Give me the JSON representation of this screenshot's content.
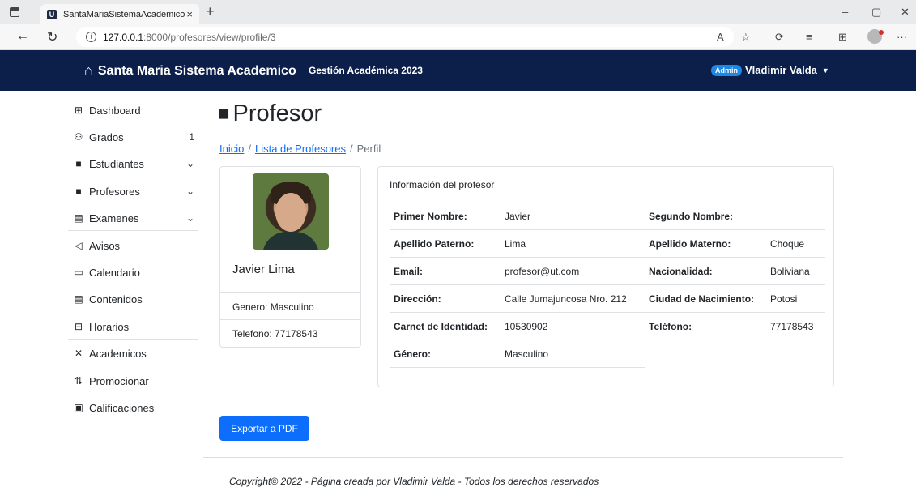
{
  "browser": {
    "tab_title": "SantaMariaSistemaAcademico",
    "tab_close": "×",
    "new_tab": "+",
    "favicon": "U",
    "url_host": "127.0.0.1",
    "url_path": ":8000/profesores/view/profile/3",
    "window_min": "–",
    "window_restore": "▢",
    "window_close": "✕"
  },
  "navbar": {
    "brand": "Santa Maria Sistema Academico",
    "subtitle": "Gestión Académica 2023",
    "badge": "Admin",
    "user": "Vladimir Valda"
  },
  "sidebar": {
    "items": [
      {
        "label": "Dashboard",
        "icon": "grid-icon"
      },
      {
        "label": "Grados",
        "icon": "diagram-icon",
        "count": "1"
      },
      {
        "label": "Estudiantes",
        "icon": "person-lines-icon"
      },
      {
        "label": "Profesores",
        "icon": "person-lines-icon"
      },
      {
        "label": "Examenes",
        "icon": "file-text-icon"
      },
      {
        "label": "Avisos",
        "icon": "megaphone-icon"
      },
      {
        "label": "Calendario",
        "icon": "calendar-icon"
      },
      {
        "label": "Contenidos",
        "icon": "file-list-icon"
      },
      {
        "label": "Horarios",
        "icon": "table-icon"
      },
      {
        "label": "Academicos",
        "icon": "tools-icon"
      },
      {
        "label": "Promocionar",
        "icon": "sort-icon"
      },
      {
        "label": "Calificaciones",
        "icon": "card-list-icon"
      }
    ]
  },
  "page": {
    "title": "Profesor",
    "breadcrumb": {
      "home": "Inicio",
      "list": "Lista de Profesores",
      "current": "Perfil",
      "sep": "/"
    }
  },
  "profile": {
    "name": "Javier Lima",
    "gender": "Genero: Masculino",
    "phone": "Telefono: 77178543"
  },
  "info": {
    "title": "Información del profesor",
    "fields": [
      {
        "label": "Primer Nombre:",
        "value": "Javier"
      },
      {
        "label": "Segundo Nombre:",
        "value": ""
      },
      {
        "label": "Apellido Paterno:",
        "value": "Lima"
      },
      {
        "label": "Apellido Materno:",
        "value": "Choque"
      },
      {
        "label": "Email:",
        "value": "profesor@ut.com"
      },
      {
        "label": "Nacionalidad:",
        "value": "Boliviana"
      },
      {
        "label": "Dirección:",
        "value": "Calle Jumajuncosa Nro. 212"
      },
      {
        "label": "Ciudad de Nacimiento:",
        "value": "Potosi"
      },
      {
        "label": "Carnet de Identidad:",
        "value": "10530902"
      },
      {
        "label": "Teléfono:",
        "value": "77178543"
      },
      {
        "label": "Género:",
        "value": "Masculino"
      }
    ]
  },
  "actions": {
    "export_pdf": "Exportar a PDF"
  },
  "footer": {
    "text": "Copyright© 2022 - Página creada por Vladimir Valda - Todos los derechos reservados"
  },
  "colors": {
    "navbar": "#0b1f4a",
    "primary": "#0d6efd",
    "badge": "#1e88e5"
  }
}
